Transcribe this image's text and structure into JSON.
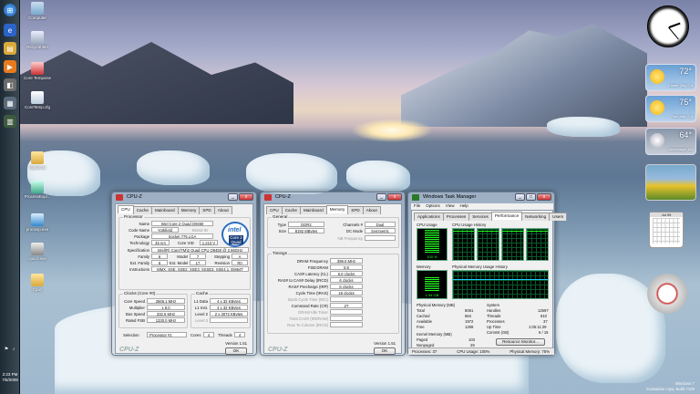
{
  "desktop": {
    "icons": [
      {
        "label": "Computer"
      },
      {
        "label": "Recycle Bin"
      },
      {
        "label": "Core Tempvise"
      },
      {
        "label": "CoreTemp.cfg"
      },
      {
        "label": "digitalcat"
      },
      {
        "label": "ProcessExpl..."
      },
      {
        "label": "procexp.exe"
      },
      {
        "label": "cpu-z.exe"
      },
      {
        "label": "Cpuz"
      }
    ],
    "watermark": {
      "line1": "Windows 7",
      "line2": "Evaluation copy. Build 7100"
    }
  },
  "taskbar": {
    "time": "2:23 PM",
    "date": "7/6/2009"
  },
  "gadgets": {
    "weather": [
      {
        "temp": "72°",
        "city": "Foster City, CA"
      },
      {
        "temp": "75°",
        "city": "Palo Alto, CA"
      },
      {
        "temp": "64°",
        "city": "Anchorage, AK"
      }
    ],
    "calendar": {
      "month": "Jul 09"
    }
  },
  "cpuz_cpu": {
    "title": "CPU-Z",
    "tabs": [
      "CPU",
      "Cache",
      "Mainboard",
      "Memory",
      "SPD",
      "About"
    ],
    "processor_label": "Processor",
    "name_label": "Name",
    "name": "Intel Core 2 Quad Q9450",
    "codename_label": "Code Name",
    "codename": "Yorkfield",
    "brandid_label": "Brand ID",
    "package_label": "Package",
    "package": "Socket 775 LGA",
    "technology_label": "Technology",
    "technology": "45 nm",
    "corevid_label": "Core VID",
    "corevid": "1.213 V",
    "spec_label": "Specification",
    "spec": "Intel(R) Core(TM)2 Quad CPU   Q9450 @ 2.66GHz",
    "family_label": "Family",
    "family": "6",
    "model_label": "Model",
    "model": "7",
    "stepping_label": "Stepping",
    "stepping": "A",
    "extfamily_label": "Ext. Family",
    "extfamily": "6",
    "extmodel_label": "Ext. Model",
    "extmodel": "17",
    "revision_label": "Revision",
    "revision": "R0",
    "instructions_label": "Instructions",
    "instructions": "MMX, SSE, SSE2, SSE3, SSSE3, SSE4.1, EM64T",
    "clocks_label": "Clocks (Core #0)",
    "corespeed_label": "Core Speed",
    "corespeed": "2666.1 MHz",
    "multiplier_label": "Multiplier",
    "multiplier": "x 8.0",
    "busspeed_label": "Bus Speed",
    "busspeed": "332.5 MHz",
    "ratedfsb_label": "Rated FSB",
    "ratedfsb": "1330.0 MHz",
    "cache_label": "Cache",
    "l1d_label": "L1 Data",
    "l1d": "4 x 32 KBytes",
    "l1i_label": "L1 Inst.",
    "l1i": "4 x 32 KBytes",
    "l2_label": "Level 2",
    "l2": "2 x 3072 KBytes",
    "l3_label": "Level 3",
    "selection_label": "Selection",
    "selection": "Processor #1",
    "cores_label": "Cores",
    "cores": "4",
    "threads_label": "Threads",
    "threads": "4",
    "version": "Version 1.51",
    "ok": "OK",
    "logo": "CPU-Z",
    "intel_text": "intel",
    "intel_sub": "Core 2 Quad"
  },
  "cpuz_mem": {
    "title": "CPU-Z",
    "tabs": [
      "CPU",
      "Cache",
      "Mainboard",
      "Memory",
      "SPD",
      "About"
    ],
    "general_label": "General",
    "type_label": "Type",
    "type": "DDR2",
    "channels_label": "Channels #",
    "channels": "Dual",
    "size_label": "Size",
    "size": "8192 MBytes",
    "dcmode_label": "DC Mode",
    "dcmode": "Symmetric",
    "nbfreq_label": "NB Frequency",
    "timings_label": "Timings",
    "dram_label": "DRAM Frequency",
    "dram": "399.0 MHz",
    "fsbdram_label": "FSB:DRAM",
    "fsbdram": "5:6",
    "cl_label": "CAS# Latency (CL)",
    "cl": "6.0 clocks",
    "trcd_label": "RAS# to CAS# Delay (tRCD)",
    "trcd": "6 clocks",
    "trp_label": "RAS# Precharge (tRP)",
    "trp": "6 clocks",
    "tras_label": "Cycle Time (tRAS)",
    "tras": "18 clocks",
    "bank_label": "Bank Cycle Time (tRC)",
    "cr_label": "Command Rate (CR)",
    "cr": "2T",
    "idle_label": "DRAM Idle Timer",
    "total_label": "Total CAS# (tRDRAM)",
    "rowtocol_label": "Row To Column (tRCD)",
    "version": "Version 1.51",
    "ok": "OK",
    "logo": "CPU-Z"
  },
  "taskmgr": {
    "title": "Windows Task Manager",
    "menu": [
      "File",
      "Options",
      "View",
      "Help"
    ],
    "tabs": [
      "Applications",
      "Processes",
      "Services",
      "Performance",
      "Networking",
      "Users"
    ],
    "cpu_usage_label": "CPU Usage",
    "cpu_usage": "100 %",
    "cpu_history_label": "CPU Usage History",
    "memory_label": "Memory",
    "memory_value": "1.94 GB",
    "mem_history_label": "Physical Memory Usage History",
    "physmem_label": "Physical Memory (MB)",
    "total_label": "Total",
    "total": "8061",
    "cached_label": "Cached",
    "cached": "664",
    "available_label": "Available",
    "available": "1972",
    "free_label": "Free",
    "free": "1289",
    "kernel_label": "Kernel Memory (MB)",
    "paged_label": "Paged",
    "paged": "103",
    "nonpaged_label": "Nonpaged",
    "nonpaged": "29",
    "system_label": "System",
    "handles_label": "Handles",
    "handles": "12597",
    "threads_label": "Threads",
    "threads": "810",
    "processes_label": "Processes",
    "processes": "37",
    "uptime_label": "Up Time",
    "uptime": "1:05:11:29",
    "commit_label": "Commit (GB)",
    "commit": "6 / 15",
    "resmon": "Resource Monitor...",
    "status_processes": "Processes: 37",
    "status_cpu": "CPU Usage: 100%",
    "status_mem": "Physical Memory: 75%",
    "cpu_level": 1.0,
    "mem_level": 0.75
  }
}
